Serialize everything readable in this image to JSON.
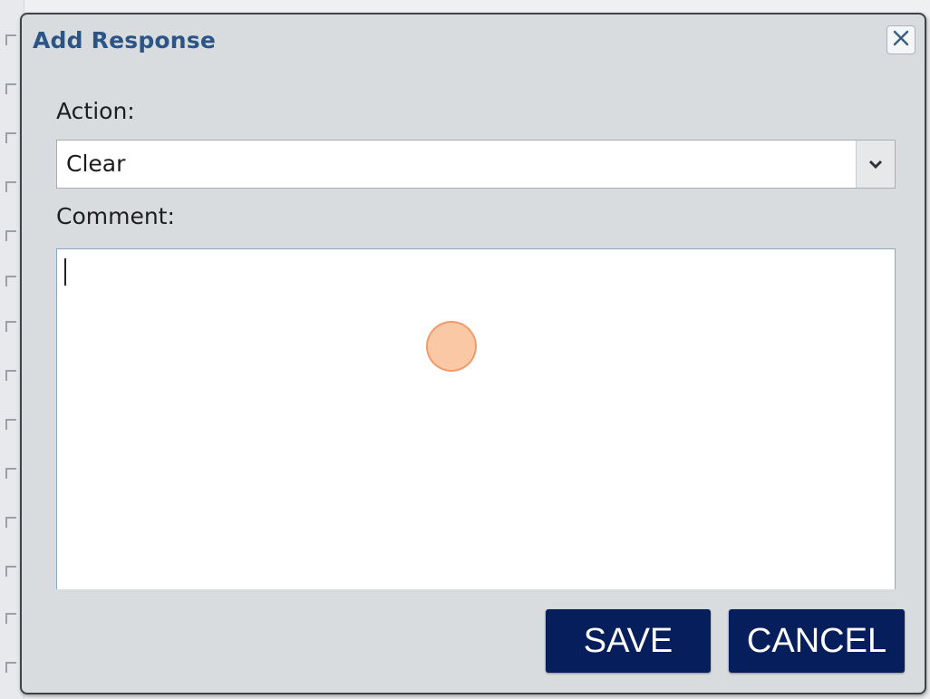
{
  "dialog": {
    "title": "Add Response",
    "close_icon": "close-icon"
  },
  "form": {
    "action_label": "Action:",
    "action_value": "Clear",
    "comment_label": "Comment:",
    "comment_value": ""
  },
  "buttons": {
    "save_label": "SAVE",
    "cancel_label": "CANCEL"
  },
  "colors": {
    "title": "#2b5586",
    "button_bg": "#061f5c",
    "dialog_bg": "#d9dcdf"
  }
}
